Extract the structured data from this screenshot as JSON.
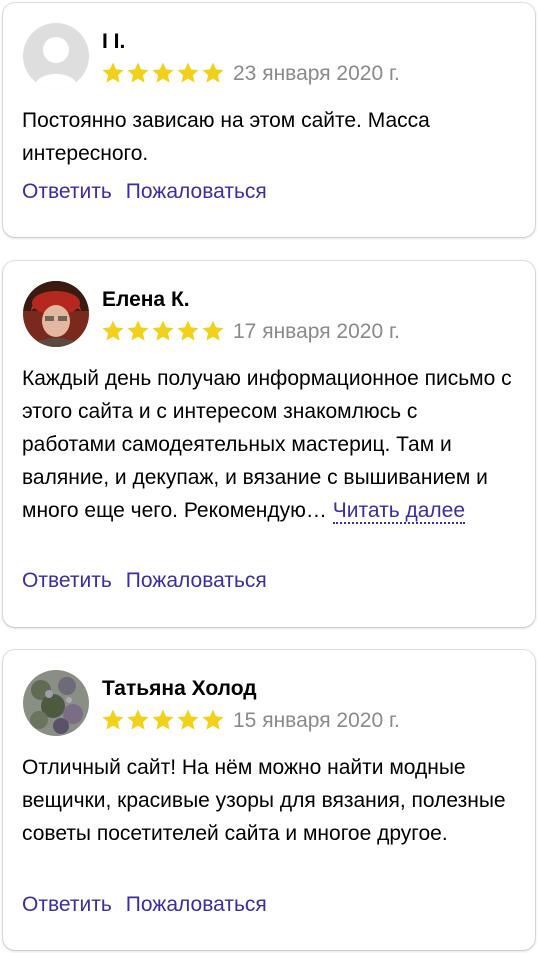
{
  "reviews": [
    {
      "author": "I I.",
      "rating": 5,
      "date": "23 января 2020 г.",
      "text": "Постоянно зависаю на этом сайте. Масса интересного.",
      "read_more": "",
      "reply_label": "Ответить",
      "complain_label": "Пожаловаться"
    },
    {
      "author": "Елена К.",
      "rating": 5,
      "date": "17 января 2020 г.",
      "text": "Каждый день получаю информационное письмо с этого сайта и с интересом знакомлюсь с работами самодеятельных мастериц. Там и валяние, и декупаж, и вязание с вышиванием и много еще чего. Рекомендую…",
      "read_more": "Читать далее",
      "reply_label": "Ответить",
      "complain_label": "Пожаловаться"
    },
    {
      "author": "Татьяна Холод",
      "rating": 5,
      "date": "15 января 2020 г.",
      "text": "Отличный сайт! На нём можно найти модные вещички, красивые узоры для вязания, полезные советы посетителей сайта и многое другое.",
      "read_more": "",
      "reply_label": "Ответить",
      "complain_label": "Пожаловаться"
    }
  ],
  "colors": {
    "link": "#3a2ea1",
    "star": "#f1d11a",
    "date": "#8a8a8a"
  },
  "icons": {
    "star": "star-icon",
    "avatar_placeholder": "user-silhouette-icon"
  }
}
